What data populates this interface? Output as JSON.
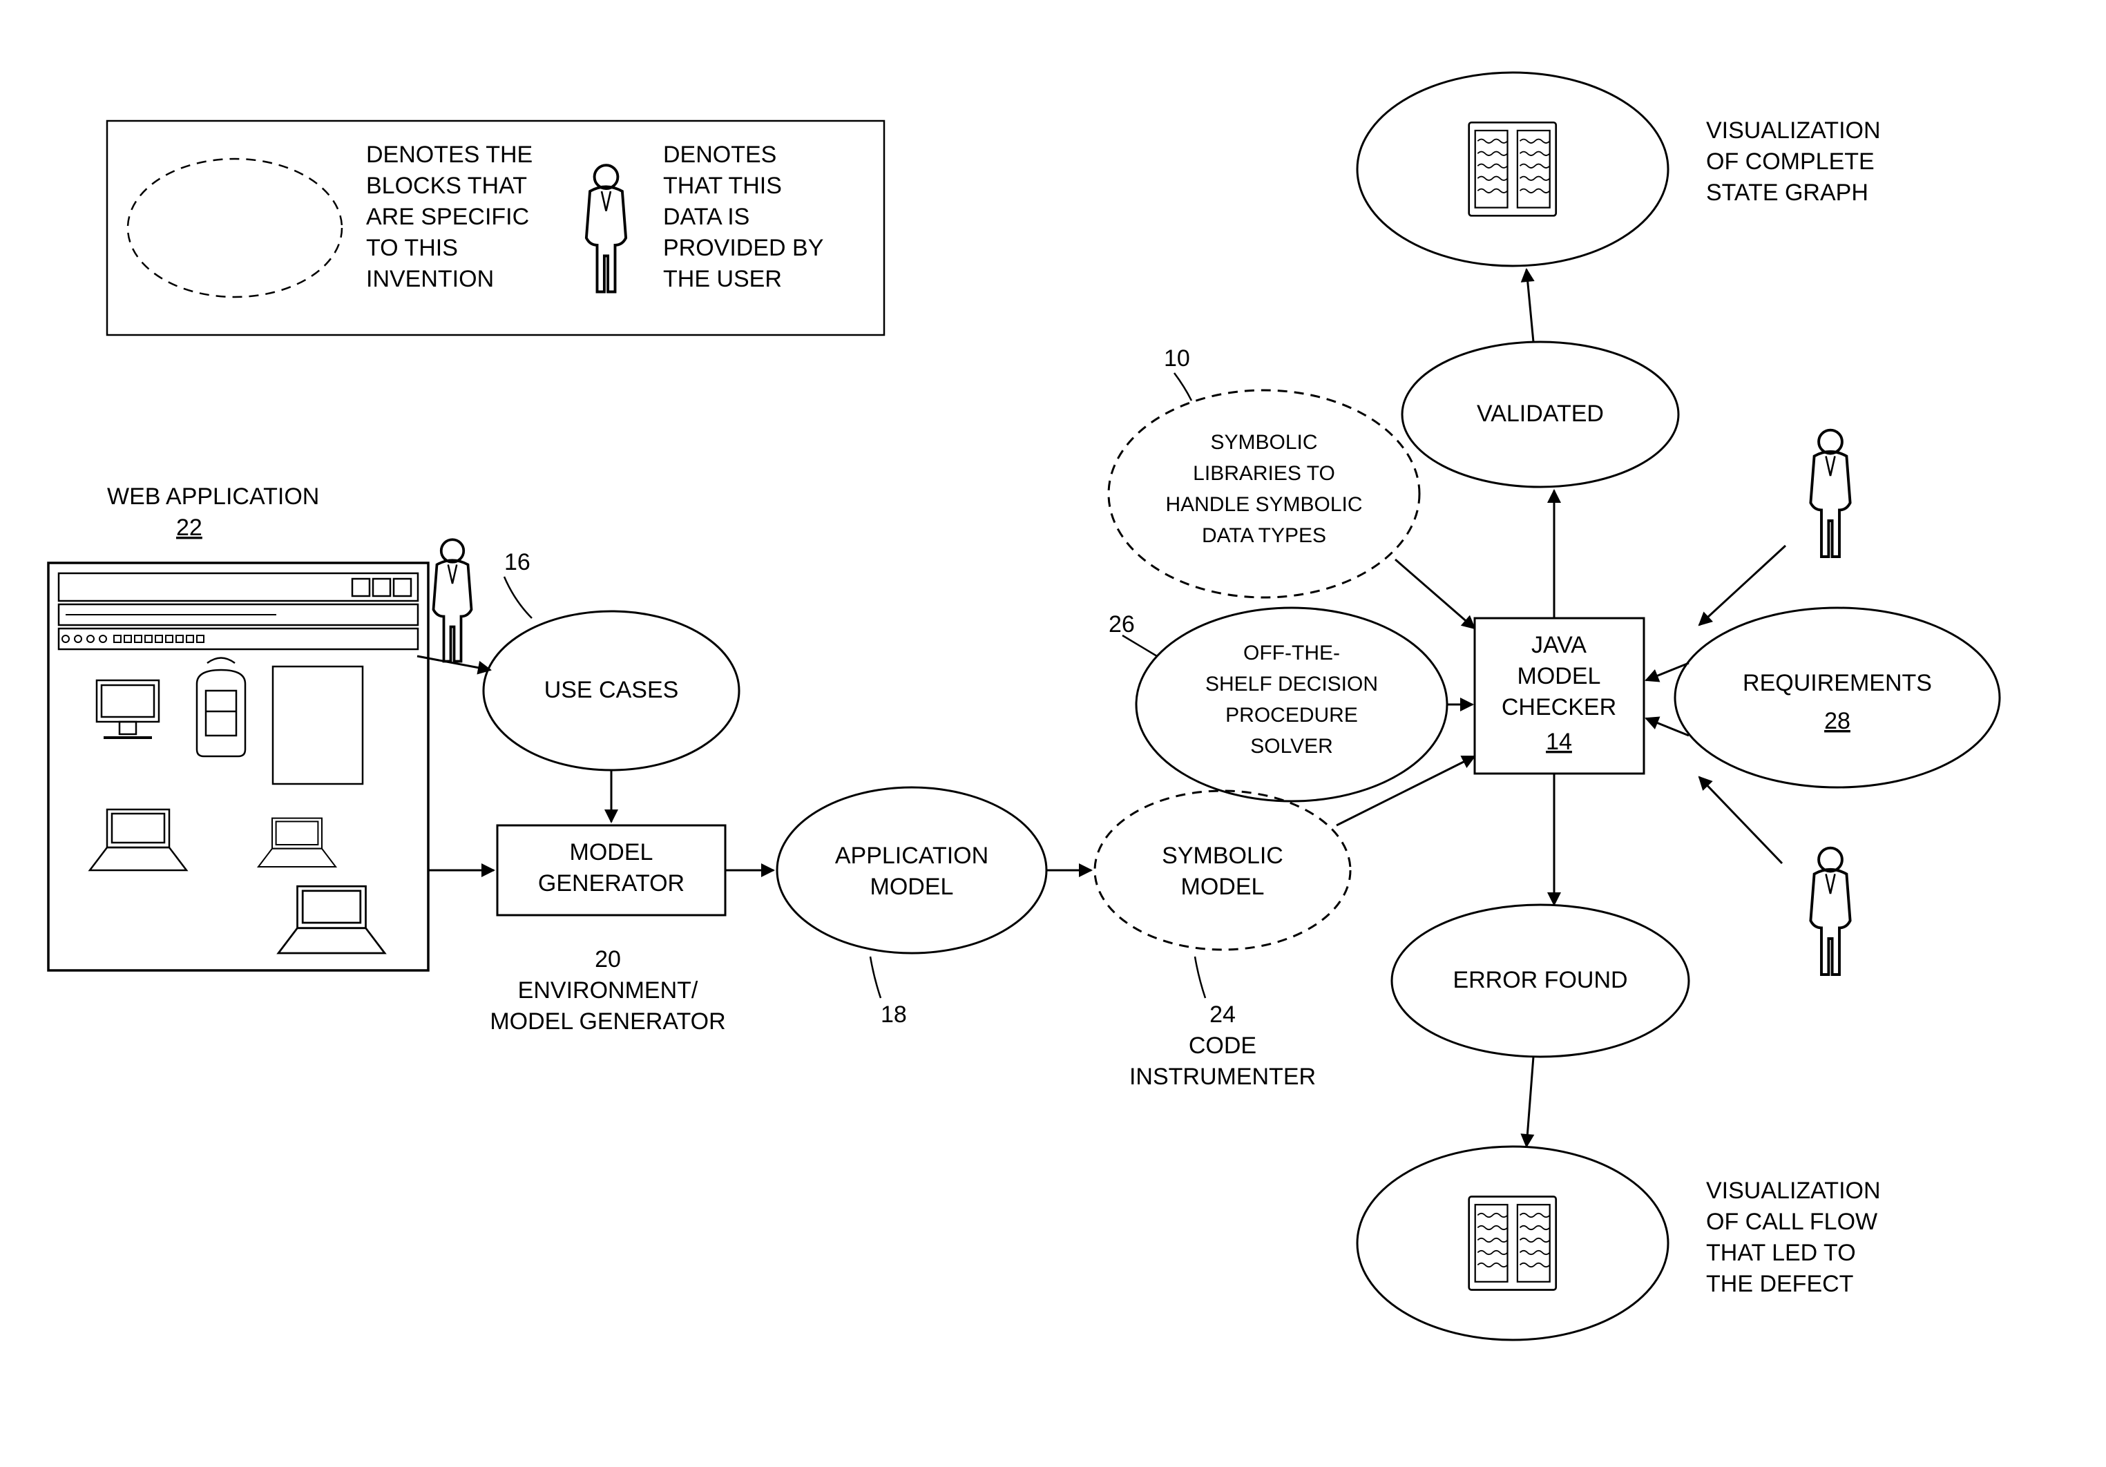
{
  "legend": {
    "ellipse_desc_l1": "DENOTES THE",
    "ellipse_desc_l2": "BLOCKS THAT",
    "ellipse_desc_l3": "ARE SPECIFIC",
    "ellipse_desc_l4": "TO THIS",
    "ellipse_desc_l5": "INVENTION",
    "user_desc_l1": "DENOTES",
    "user_desc_l2": "THAT THIS",
    "user_desc_l3": "DATA IS",
    "user_desc_l4": "PROVIDED BY",
    "user_desc_l5": "THE USER"
  },
  "labels": {
    "web_app": "WEB APPLICATION",
    "web_app_ref": "22",
    "use_cases": "USE CASES",
    "use_cases_ref": "16",
    "model_generator_l1": "MODEL",
    "model_generator_l2": "GENERATOR",
    "env_model_l1": "ENVIRONMENT/",
    "env_model_l2": "MODEL GENERATOR",
    "env_model_ref": "20",
    "app_model_l1": "APPLICATION",
    "app_model_l2": "MODEL",
    "app_model_ref": "18",
    "symbolic_model_l1": "SYMBOLIC",
    "symbolic_model_l2": "MODEL",
    "code_instr_l1": "CODE",
    "code_instr_l2": "INSTRUMENTER",
    "code_instr_ref": "24",
    "sym_lib_l1": "SYMBOLIC",
    "sym_lib_l2": "LIBRARIES TO",
    "sym_lib_l3": "HANDLE SYMBOLIC",
    "sym_lib_l4": "DATA TYPES",
    "sym_lib_ref": "10",
    "solver_l1": "OFF-THE-",
    "solver_l2": "SHELF DECISION",
    "solver_l3": "PROCEDURE",
    "solver_l4": "SOLVER",
    "solver_ref": "26",
    "java_l1": "JAVA",
    "java_l2": "MODEL",
    "java_l3": "CHECKER",
    "java_ref": "14",
    "requirements": "REQUIREMENTS",
    "requirements_ref": "28",
    "validated": "VALIDATED",
    "error_found": "ERROR FOUND",
    "viz_top_l1": "VISUALIZATION",
    "viz_top_l2": "OF COMPLETE",
    "viz_top_l3": "STATE GRAPH",
    "viz_bot_l1": "VISUALIZATION",
    "viz_bot_l2": "OF CALL FLOW",
    "viz_bot_l3": "THAT LED TO",
    "viz_bot_l4": "THE DEFECT"
  }
}
